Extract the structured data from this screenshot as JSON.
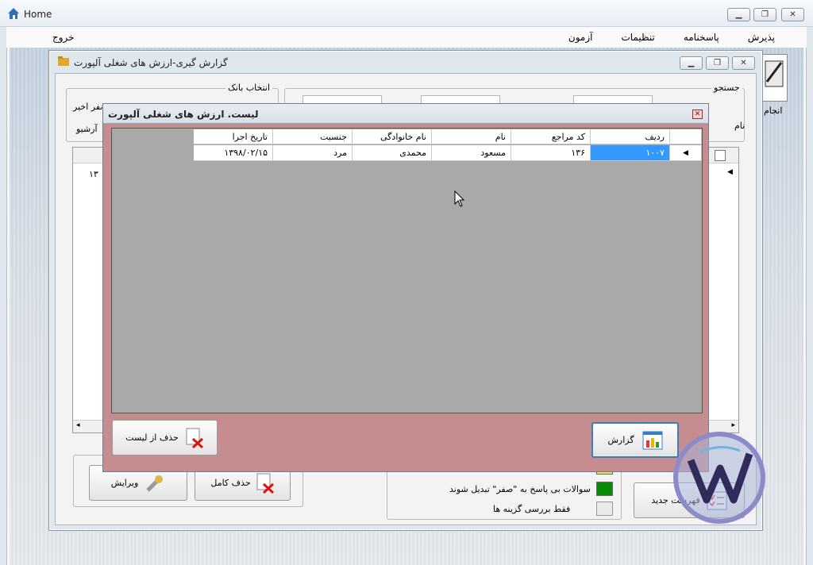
{
  "home": {
    "title": "Home",
    "menu": [
      "پذیرش",
      "پاسخنامه",
      "تنظیمات",
      "آزمون"
    ],
    "exit": "خروج"
  },
  "report_window": {
    "title": "گزارش گیری-ارزش های شغلی آلپورت",
    "search_caption": "جستجو",
    "bank_caption": "انتخاب بانک",
    "latest_label": "نفر اخیر",
    "archive_label": "آرشیو",
    "name_label": "نام",
    "exec_label": "انجام",
    "bg_row_value": "۱۳",
    "edit_button": "ویرایش",
    "delete_all_button": "حذف کامل",
    "new_list_button": "فهرست جدید",
    "options": [
      "سوالات بی پاسخ به \"صفر\" تبدیل شوند",
      "فقط بررسی گزینه ها"
    ]
  },
  "dialog": {
    "title": "لیست. ارزش های شغلی آلپورت",
    "columns": [
      "ردیف",
      "کد مراجع",
      "نام",
      "نام خانوادگی",
      "جنسیت",
      "تاریخ اجرا"
    ],
    "rows": [
      [
        "۱۰۰۷",
        "۱۳۶",
        "مسعود",
        "محمدی",
        "مرد",
        "۱۳۹۸/۰۲/۱۵"
      ]
    ],
    "remove_button": "حذف از لیست",
    "report_button": "گزارش"
  },
  "colors": {
    "dialog_bg": "#c58d8f",
    "selection": "#3399ff",
    "option_yellow": "#e8e84a",
    "option_green": "#0a8a0a"
  }
}
